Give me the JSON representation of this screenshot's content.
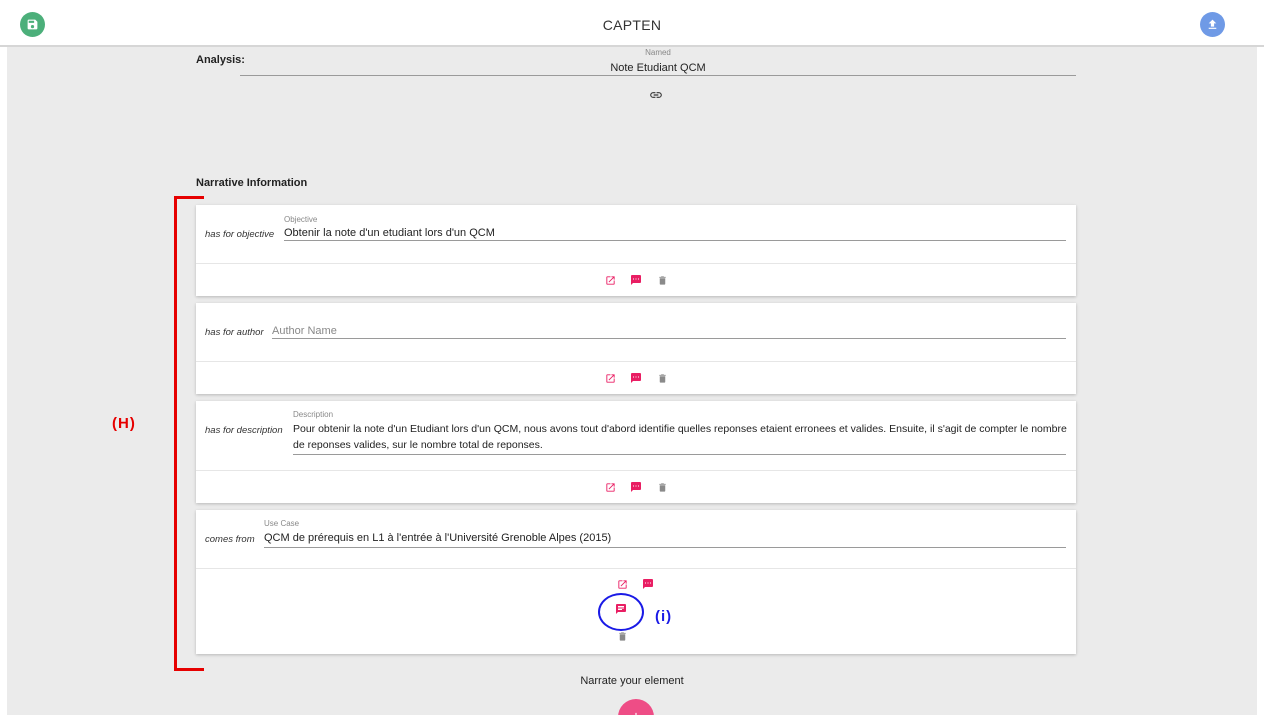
{
  "app": {
    "title": "CAPTEN"
  },
  "icons": {
    "save": "save-icon",
    "upload": "upload-icon",
    "link": "link-icon",
    "edit": "open-in-new-icon",
    "comment": "comment-icon",
    "delete": "trash-icon",
    "add": "plus-icon"
  },
  "colors": {
    "accent": "#e91e63",
    "save_fab": "#4caf7a",
    "upload_fab": "#6f9ae6",
    "annotation_red": "#e60000",
    "annotation_blue": "#1a1ae6"
  },
  "analysis": {
    "label": "Analysis:",
    "named_caption": "Named",
    "named_value": "Note Etudiant QCM"
  },
  "narrative": {
    "heading": "Narrative Information",
    "cards": [
      {
        "predicate": "has for objective",
        "caption": "Objective",
        "value": "Obtenir la note d'un etudiant lors d'un QCM"
      },
      {
        "predicate": "has for author",
        "caption": "",
        "placeholder": "Author Name"
      },
      {
        "predicate": "has for description",
        "caption": "Description",
        "value_line1": "Pour obtenir la note d'un Etudiant lors d'un QCM, nous avons tout d'abord identifie quelles reponses etaient erronees et valides. Ensuite, il s'agit de compter le nombre",
        "value_line2": "de reponses valides, sur le nombre total de reponses."
      },
      {
        "predicate": "comes from",
        "caption": "Use Case",
        "value": "QCM de prérequis en L1 à l'entrée à l'Université Grenoble Alpes (2015)"
      }
    ]
  },
  "annotations": {
    "bracket_label": "(H)",
    "circle_label": "(i)"
  },
  "footer": {
    "narrate_label": "Narrate your element"
  }
}
